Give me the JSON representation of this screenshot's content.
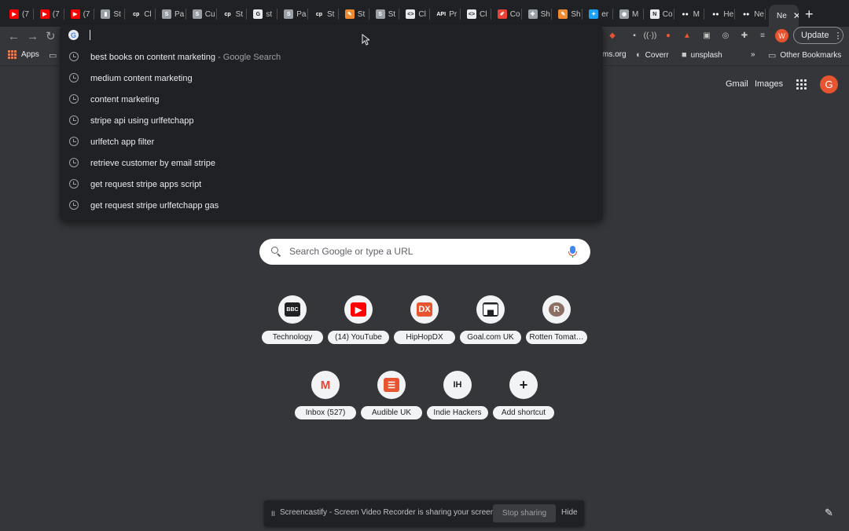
{
  "tabs": [
    {
      "label": "(7",
      "icon": "youtube-icon",
      "color": "#ff0000",
      "glyph": "▶"
    },
    {
      "label": "(7",
      "icon": "youtube-icon",
      "color": "#ff0000",
      "glyph": "▶"
    },
    {
      "label": "(7",
      "icon": "youtube-icon",
      "color": "#ff0000",
      "glyph": "▶"
    },
    {
      "label": "St",
      "icon": "document-icon",
      "color": "#9aa0a6",
      "glyph": "▮"
    },
    {
      "label": "Cl",
      "icon": "cp-icon",
      "color": "#202124",
      "glyph": "cp"
    },
    {
      "label": "Pa",
      "icon": "s-icon",
      "color": "#9aa0a6",
      "glyph": "S"
    },
    {
      "label": "Cu",
      "icon": "s-icon",
      "color": "#9aa0a6",
      "glyph": "S"
    },
    {
      "label": "St",
      "icon": "cp-icon",
      "color": "#202124",
      "glyph": "cp"
    },
    {
      "label": "st",
      "icon": "google-icon",
      "color": "#e8eaed",
      "glyph": "G"
    },
    {
      "label": "Pa",
      "icon": "s-icon",
      "color": "#9aa0a6",
      "glyph": "S"
    },
    {
      "label": "St",
      "icon": "cp-icon",
      "color": "#202124",
      "glyph": "cp"
    },
    {
      "label": "St",
      "icon": "feather-icon",
      "color": "#f28b30",
      "glyph": "✎"
    },
    {
      "label": "St",
      "icon": "s-icon",
      "color": "#9aa0a6",
      "glyph": "S"
    },
    {
      "label": "Cl",
      "icon": "code-icon",
      "color": "#e8eaed",
      "glyph": "<>"
    },
    {
      "label": "Pr",
      "icon": "api-icon",
      "color": "#202124",
      "glyph": "API"
    },
    {
      "label": "Cl",
      "icon": "code-icon",
      "color": "#e8eaed",
      "glyph": "<>"
    },
    {
      "label": "Co",
      "icon": "brush-icon",
      "color": "#ea4335",
      "glyph": "✐"
    },
    {
      "label": "Sh",
      "icon": "cross-icon",
      "color": "#9aa0a6",
      "glyph": "✚"
    },
    {
      "label": "Sh",
      "icon": "feather-icon",
      "color": "#f28b30",
      "glyph": "✎"
    },
    {
      "label": "er",
      "icon": "twitter-icon",
      "color": "#1da1f2",
      "glyph": "✦"
    },
    {
      "label": "M",
      "icon": "globe-icon",
      "color": "#9aa0a6",
      "glyph": "◉"
    },
    {
      "label": "Co",
      "icon": "notion-icon",
      "color": "#e8eaed",
      "glyph": "N"
    },
    {
      "label": "M",
      "icon": "medium-icon",
      "color": "#202124",
      "glyph": "●●"
    },
    {
      "label": "He",
      "icon": "medium-icon",
      "color": "#202124",
      "glyph": "●●"
    },
    {
      "label": "Ne",
      "icon": "medium-icon",
      "color": "#202124",
      "glyph": "●●"
    }
  ],
  "active_tab": {
    "label": "Ne",
    "close": "✕"
  },
  "new_tab_glyph": "+",
  "nav": {
    "back": "←",
    "forward": "→",
    "reload": "↻"
  },
  "update_button": {
    "label": "Update",
    "menu": "⋮"
  },
  "profile_initial_small": "W",
  "bookmarks": {
    "apps": "Apps",
    "items": [
      {
        "label": "ms.org"
      },
      {
        "label": "Coverr"
      },
      {
        "label": "unsplash"
      }
    ],
    "more": "»",
    "other": "Other Bookmarks"
  },
  "omnibox": {
    "value": "",
    "suggestions": [
      {
        "text": "best books on content marketing",
        "hint": " - Google Search"
      },
      {
        "text": "medium content marketing",
        "hint": ""
      },
      {
        "text": "content marketing",
        "hint": ""
      },
      {
        "text": "stripe api using urlfetchapp",
        "hint": ""
      },
      {
        "text": "urlfetch app filter",
        "hint": ""
      },
      {
        "text": "retrieve customer by email stripe",
        "hint": ""
      },
      {
        "text": "get request stripe apps script",
        "hint": ""
      },
      {
        "text": "get request stripe urlfetchapp gas",
        "hint": ""
      }
    ]
  },
  "header_links": {
    "gmail": "Gmail",
    "images": "Images",
    "profile_initial": "G"
  },
  "search": {
    "placeholder": "Search Google or type a URL",
    "value": ""
  },
  "shortcuts": [
    {
      "label": "Technology",
      "icon": "bbc-icon",
      "glyph": "BBC",
      "bg": "#202124",
      "fg": "#ffffff"
    },
    {
      "label": "(14) YouTube",
      "icon": "youtube-icon",
      "glyph": "▶",
      "bg": "#ff0000",
      "fg": "#ffffff"
    },
    {
      "label": "HipHopDX",
      "icon": "hiphopdx-icon",
      "glyph": "DX",
      "bg": "#e8542f",
      "fg": "#ffffff"
    },
    {
      "label": "Goal.com UK",
      "icon": "goal-icon",
      "glyph": "▛▜",
      "bg": "#202124",
      "fg": "#ffffff"
    },
    {
      "label": "Rotten Tomat…",
      "icon": "rotten-tomatoes-icon",
      "glyph": "R",
      "bg": "#8d6e63",
      "fg": "#ffffff"
    },
    {
      "label": "Inbox (527)",
      "icon": "gmail-icon",
      "glyph": "M",
      "bg": "#f1f3f4",
      "fg": "#ea4335"
    },
    {
      "label": "Audible UK",
      "icon": "audible-icon",
      "glyph": "☰",
      "bg": "#e8542f",
      "fg": "#ffffff"
    },
    {
      "label": "Indie Hackers",
      "icon": "indie-hackers-icon",
      "glyph": "IH",
      "bg": "#f1f3f4",
      "fg": "#202124"
    },
    {
      "label": "Add shortcut",
      "icon": "plus-icon",
      "glyph": "+",
      "bg": "#f1f3f4",
      "fg": "#202124"
    }
  ],
  "screencastify": {
    "message": "Screencastify - Screen Video Recorder is sharing your screen.",
    "stop": "Stop sharing",
    "hide": "Hide",
    "pause_glyph": "II"
  },
  "customize_glyph": "✎"
}
